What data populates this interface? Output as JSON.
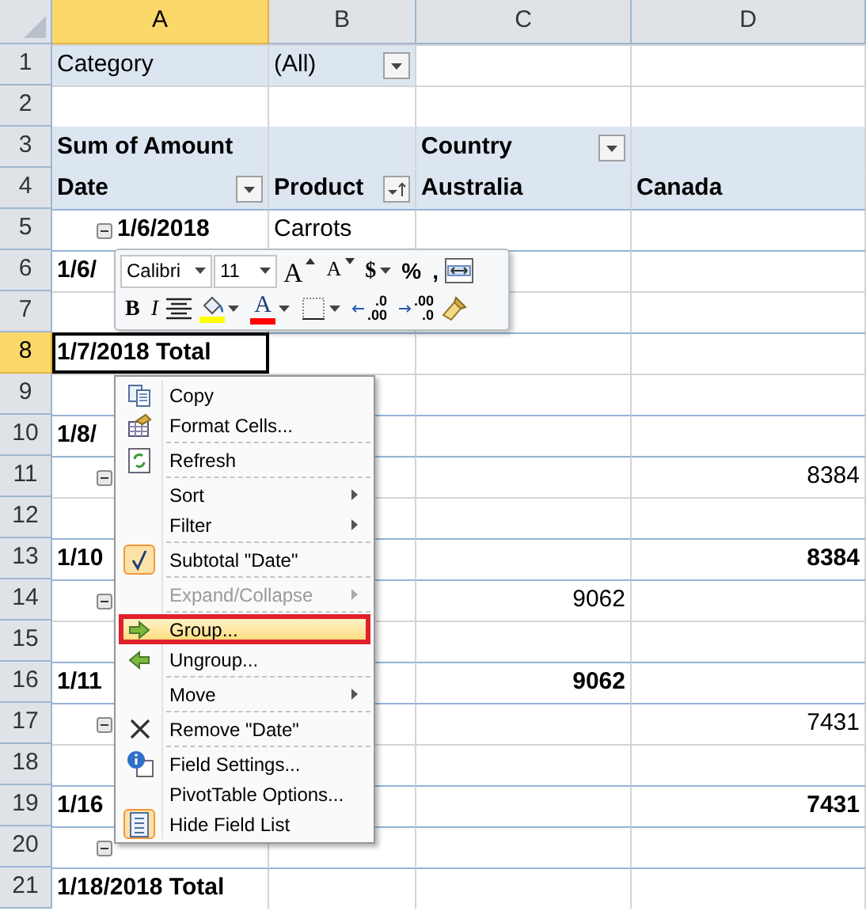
{
  "columns": [
    {
      "label": "A",
      "selected": true
    },
    {
      "label": "B",
      "selected": false
    },
    {
      "label": "C",
      "selected": false
    },
    {
      "label": "D",
      "selected": false
    }
  ],
  "rows": [
    {
      "number": "1",
      "kind": "filter",
      "selected": false,
      "cells": {
        "A": {
          "text": "Category"
        },
        "B": {
          "text": "(All)",
          "filter": true,
          "sorted": false
        }
      }
    },
    {
      "number": "2",
      "kind": "blank",
      "selected": false,
      "cells": {}
    },
    {
      "number": "3",
      "kind": "header",
      "selected": false,
      "cells": {
        "A": {
          "text": "Sum of Amount"
        },
        "C": {
          "text": "Country",
          "filter": true,
          "sorted": false
        }
      }
    },
    {
      "number": "4",
      "kind": "header",
      "selected": false,
      "cells": {
        "A": {
          "text": "Date",
          "filter": true,
          "sorted": false
        },
        "B": {
          "text": "Product",
          "filter": true,
          "sorted": true
        },
        "C": {
          "text": "Australia"
        },
        "D": {
          "text": "Canada"
        }
      }
    },
    {
      "number": "5",
      "kind": "item",
      "selected": false,
      "cells": {
        "A": {
          "text": "1/6/2018"
        },
        "B": {
          "text": "Carrots"
        }
      }
    },
    {
      "number": "6",
      "kind": "total",
      "selected": false,
      "cells": {
        "A": {
          "text": "1/6/"
        }
      }
    },
    {
      "number": "7",
      "kind": "blank",
      "selected": false,
      "cells": {}
    },
    {
      "number": "8",
      "kind": "total",
      "selected": true,
      "cells": {
        "A": {
          "text": "1/7/2018 Total"
        }
      }
    },
    {
      "number": "9",
      "kind": "blank",
      "selected": false,
      "cells": {}
    },
    {
      "number": "10",
      "kind": "total",
      "selected": false,
      "cells": {
        "A": {
          "text": "1/8/"
        }
      }
    },
    {
      "number": "11",
      "kind": "item",
      "selected": false,
      "cells": {
        "D": {
          "text": "8384"
        }
      }
    },
    {
      "number": "12",
      "kind": "blank",
      "selected": false,
      "cells": {}
    },
    {
      "number": "13",
      "kind": "total",
      "selected": false,
      "cells": {
        "A": {
          "text": "1/10"
        },
        "D": {
          "text": "8384"
        }
      }
    },
    {
      "number": "14",
      "kind": "item",
      "selected": false,
      "cells": {
        "C": {
          "text": "9062"
        }
      }
    },
    {
      "number": "15",
      "kind": "blank",
      "selected": false,
      "cells": {}
    },
    {
      "number": "16",
      "kind": "total",
      "selected": false,
      "cells": {
        "A": {
          "text": "1/11"
        },
        "C": {
          "text": "9062"
        }
      }
    },
    {
      "number": "17",
      "kind": "item",
      "selected": false,
      "cells": {
        "D": {
          "text": "7431"
        }
      }
    },
    {
      "number": "18",
      "kind": "blank",
      "selected": false,
      "cells": {}
    },
    {
      "number": "19",
      "kind": "total",
      "selected": false,
      "cells": {
        "A": {
          "text": "1/16"
        },
        "D": {
          "text": "7431"
        }
      }
    },
    {
      "number": "20",
      "kind": "item",
      "selected": false,
      "cells": {}
    },
    {
      "number": "21",
      "kind": "total",
      "selected": false,
      "cells": {
        "A": {
          "text": "1/18/2018 Total"
        }
      }
    }
  ],
  "mini_toolbar": {
    "font_items": [
      {
        "kind": "field",
        "label": "Calibri"
      },
      {
        "kind": "size",
        "label": "11"
      },
      {
        "kind": "grow",
        "label": "A"
      },
      {
        "kind": "shrink",
        "label": "A"
      },
      {
        "kind": "currency",
        "label": "$"
      },
      {
        "kind": "text",
        "label": "%"
      },
      {
        "kind": "text",
        "label": ","
      },
      {
        "kind": "merge"
      }
    ],
    "style_items": [
      {
        "kind": "bold",
        "label": "B"
      },
      {
        "kind": "italic",
        "label": "I"
      },
      {
        "kind": "center"
      },
      {
        "kind": "fill",
        "color": "#ffff00"
      },
      {
        "kind": "fontcolor",
        "label": "A",
        "color": "#ff0000"
      },
      {
        "kind": "borders"
      },
      {
        "kind": "decinc",
        "lines": [
          ".0",
          ".00"
        ]
      },
      {
        "kind": "decdec",
        "lines": [
          ".00",
          ".0"
        ]
      },
      {
        "kind": "painter"
      }
    ]
  },
  "context_menu": [
    {
      "kind": "copy",
      "label": "Copy",
      "submenu": false,
      "disabled": false,
      "checked": false,
      "selected": false
    },
    {
      "kind": "format",
      "label": "Format Cells...",
      "submenu": false,
      "disabled": false,
      "checked": false,
      "selected": false
    },
    {
      "kind": "separator"
    },
    {
      "kind": "refresh",
      "label": "Refresh",
      "submenu": false,
      "disabled": false,
      "checked": false,
      "selected": false
    },
    {
      "kind": "separator"
    },
    {
      "kind": "plain",
      "label": "Sort",
      "submenu": true,
      "disabled": false,
      "checked": false,
      "selected": false
    },
    {
      "kind": "plain",
      "label": "Filter",
      "submenu": true,
      "disabled": false,
      "checked": false,
      "selected": false
    },
    {
      "kind": "separator"
    },
    {
      "kind": "check",
      "label": "Subtotal \"Date\"",
      "submenu": false,
      "disabled": false,
      "checked": true,
      "selected": false
    },
    {
      "kind": "separator"
    },
    {
      "kind": "plain",
      "label": "Expand/Collapse",
      "submenu": true,
      "disabled": true,
      "checked": false,
      "selected": false
    },
    {
      "kind": "separator"
    },
    {
      "kind": "group",
      "label": "Group...",
      "submenu": false,
      "disabled": false,
      "checked": false,
      "selected": true
    },
    {
      "kind": "ungroup",
      "label": "Ungroup...",
      "submenu": false,
      "disabled": false,
      "checked": false,
      "selected": false
    },
    {
      "kind": "separator"
    },
    {
      "kind": "plain",
      "label": "Move",
      "submenu": true,
      "disabled": false,
      "checked": false,
      "selected": false
    },
    {
      "kind": "separator"
    },
    {
      "kind": "remove",
      "label": "Remove \"Date\"",
      "submenu": false,
      "disabled": false,
      "checked": false,
      "selected": false
    },
    {
      "kind": "separator"
    },
    {
      "kind": "settings",
      "label": "Field Settings...",
      "submenu": false,
      "disabled": false,
      "checked": false,
      "selected": false
    },
    {
      "kind": "plain",
      "label": "PivotTable Options...",
      "submenu": false,
      "disabled": false,
      "checked": false,
      "selected": false
    },
    {
      "kind": "fieldlist",
      "label": "Hide Field List",
      "submenu": false,
      "disabled": false,
      "checked": true,
      "selected": false
    }
  ]
}
